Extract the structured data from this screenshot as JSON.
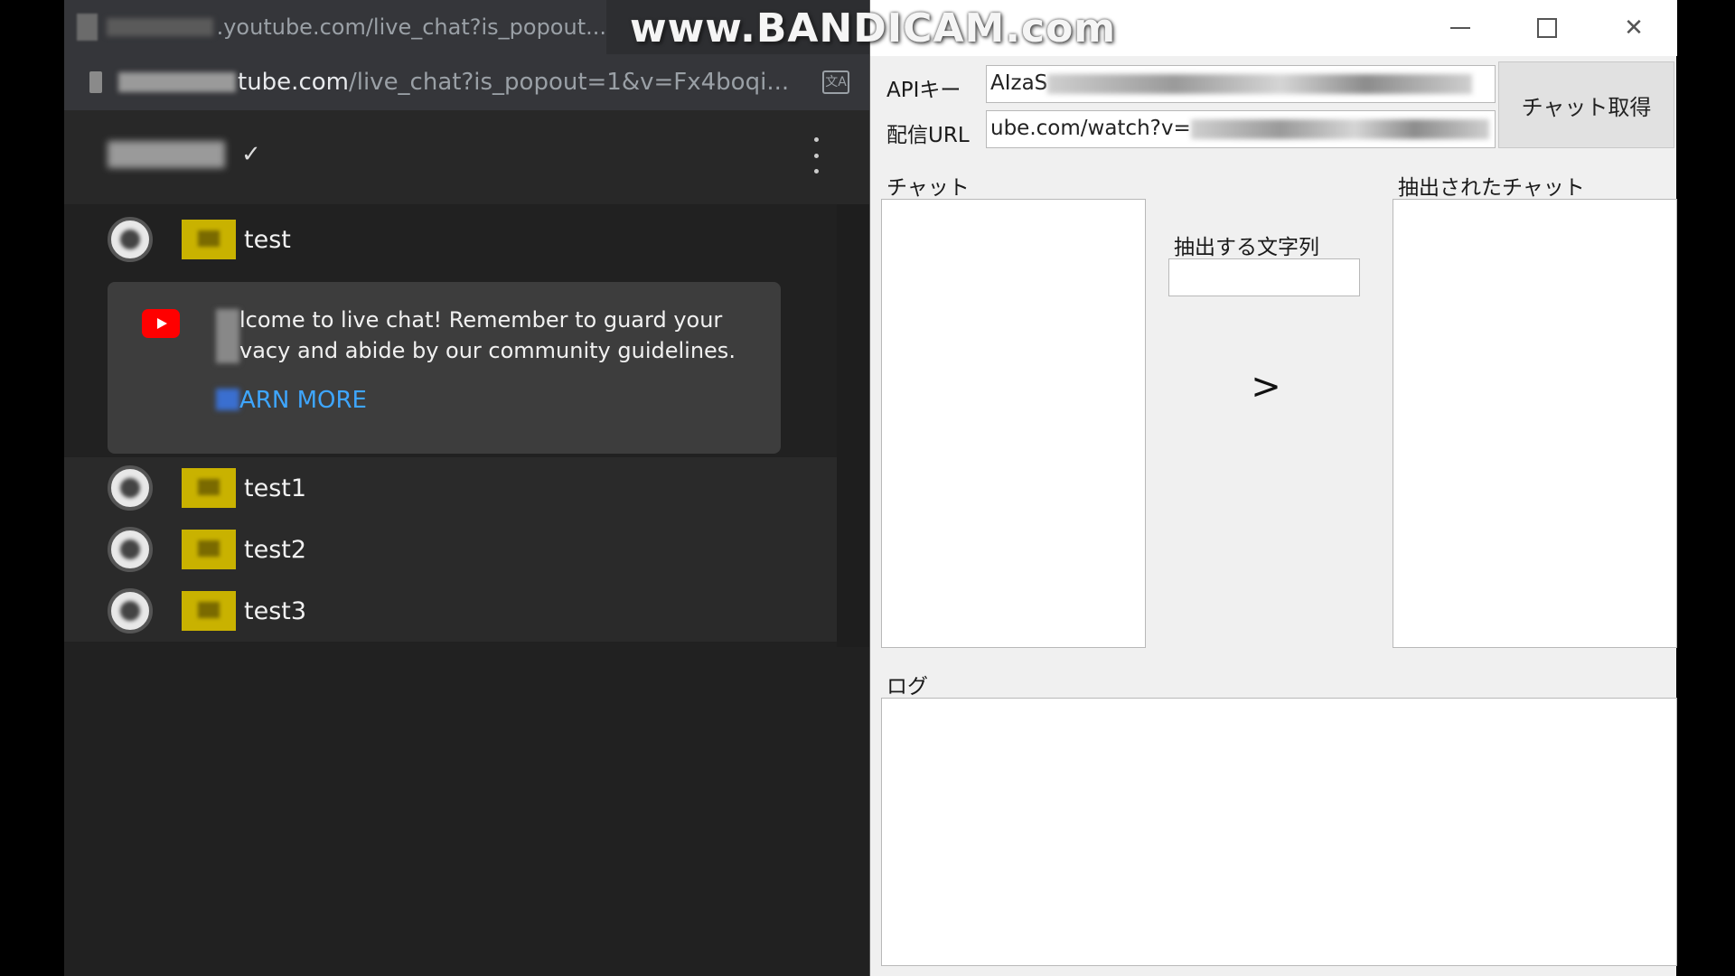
{
  "watermark": "www.BANDICAM.com",
  "browser": {
    "tab_title": ".youtube.com/live_chat?is_popout...",
    "address_host": "tube.com",
    "address_path": "/live_chat?is_popout=1&v=Fx4boqi...",
    "messages_top": [
      {
        "text": "test"
      }
    ],
    "welcome": {
      "line1": "lcome to live chat! Remember to guard your",
      "line2": "vacy and abide by our community guidelines.",
      "link": "ARN MORE"
    },
    "messages_bottom": [
      {
        "text": "test1"
      },
      {
        "text": "test2"
      },
      {
        "text": "test3"
      }
    ]
  },
  "app": {
    "api_key_label": "APIキー",
    "api_key_value": "AIzaS",
    "url_label": "配信URL",
    "url_value": "ube.com/watch?v=",
    "fetch_button": "チャット取得",
    "chat_label": "チャット",
    "extract_label": "抽出する文字列",
    "extract_value": "",
    "arrow_button": ">",
    "extracted_label": "抽出されたチャット",
    "log_label": "ログ"
  },
  "window_controls": {
    "close_glyph": "✕"
  }
}
